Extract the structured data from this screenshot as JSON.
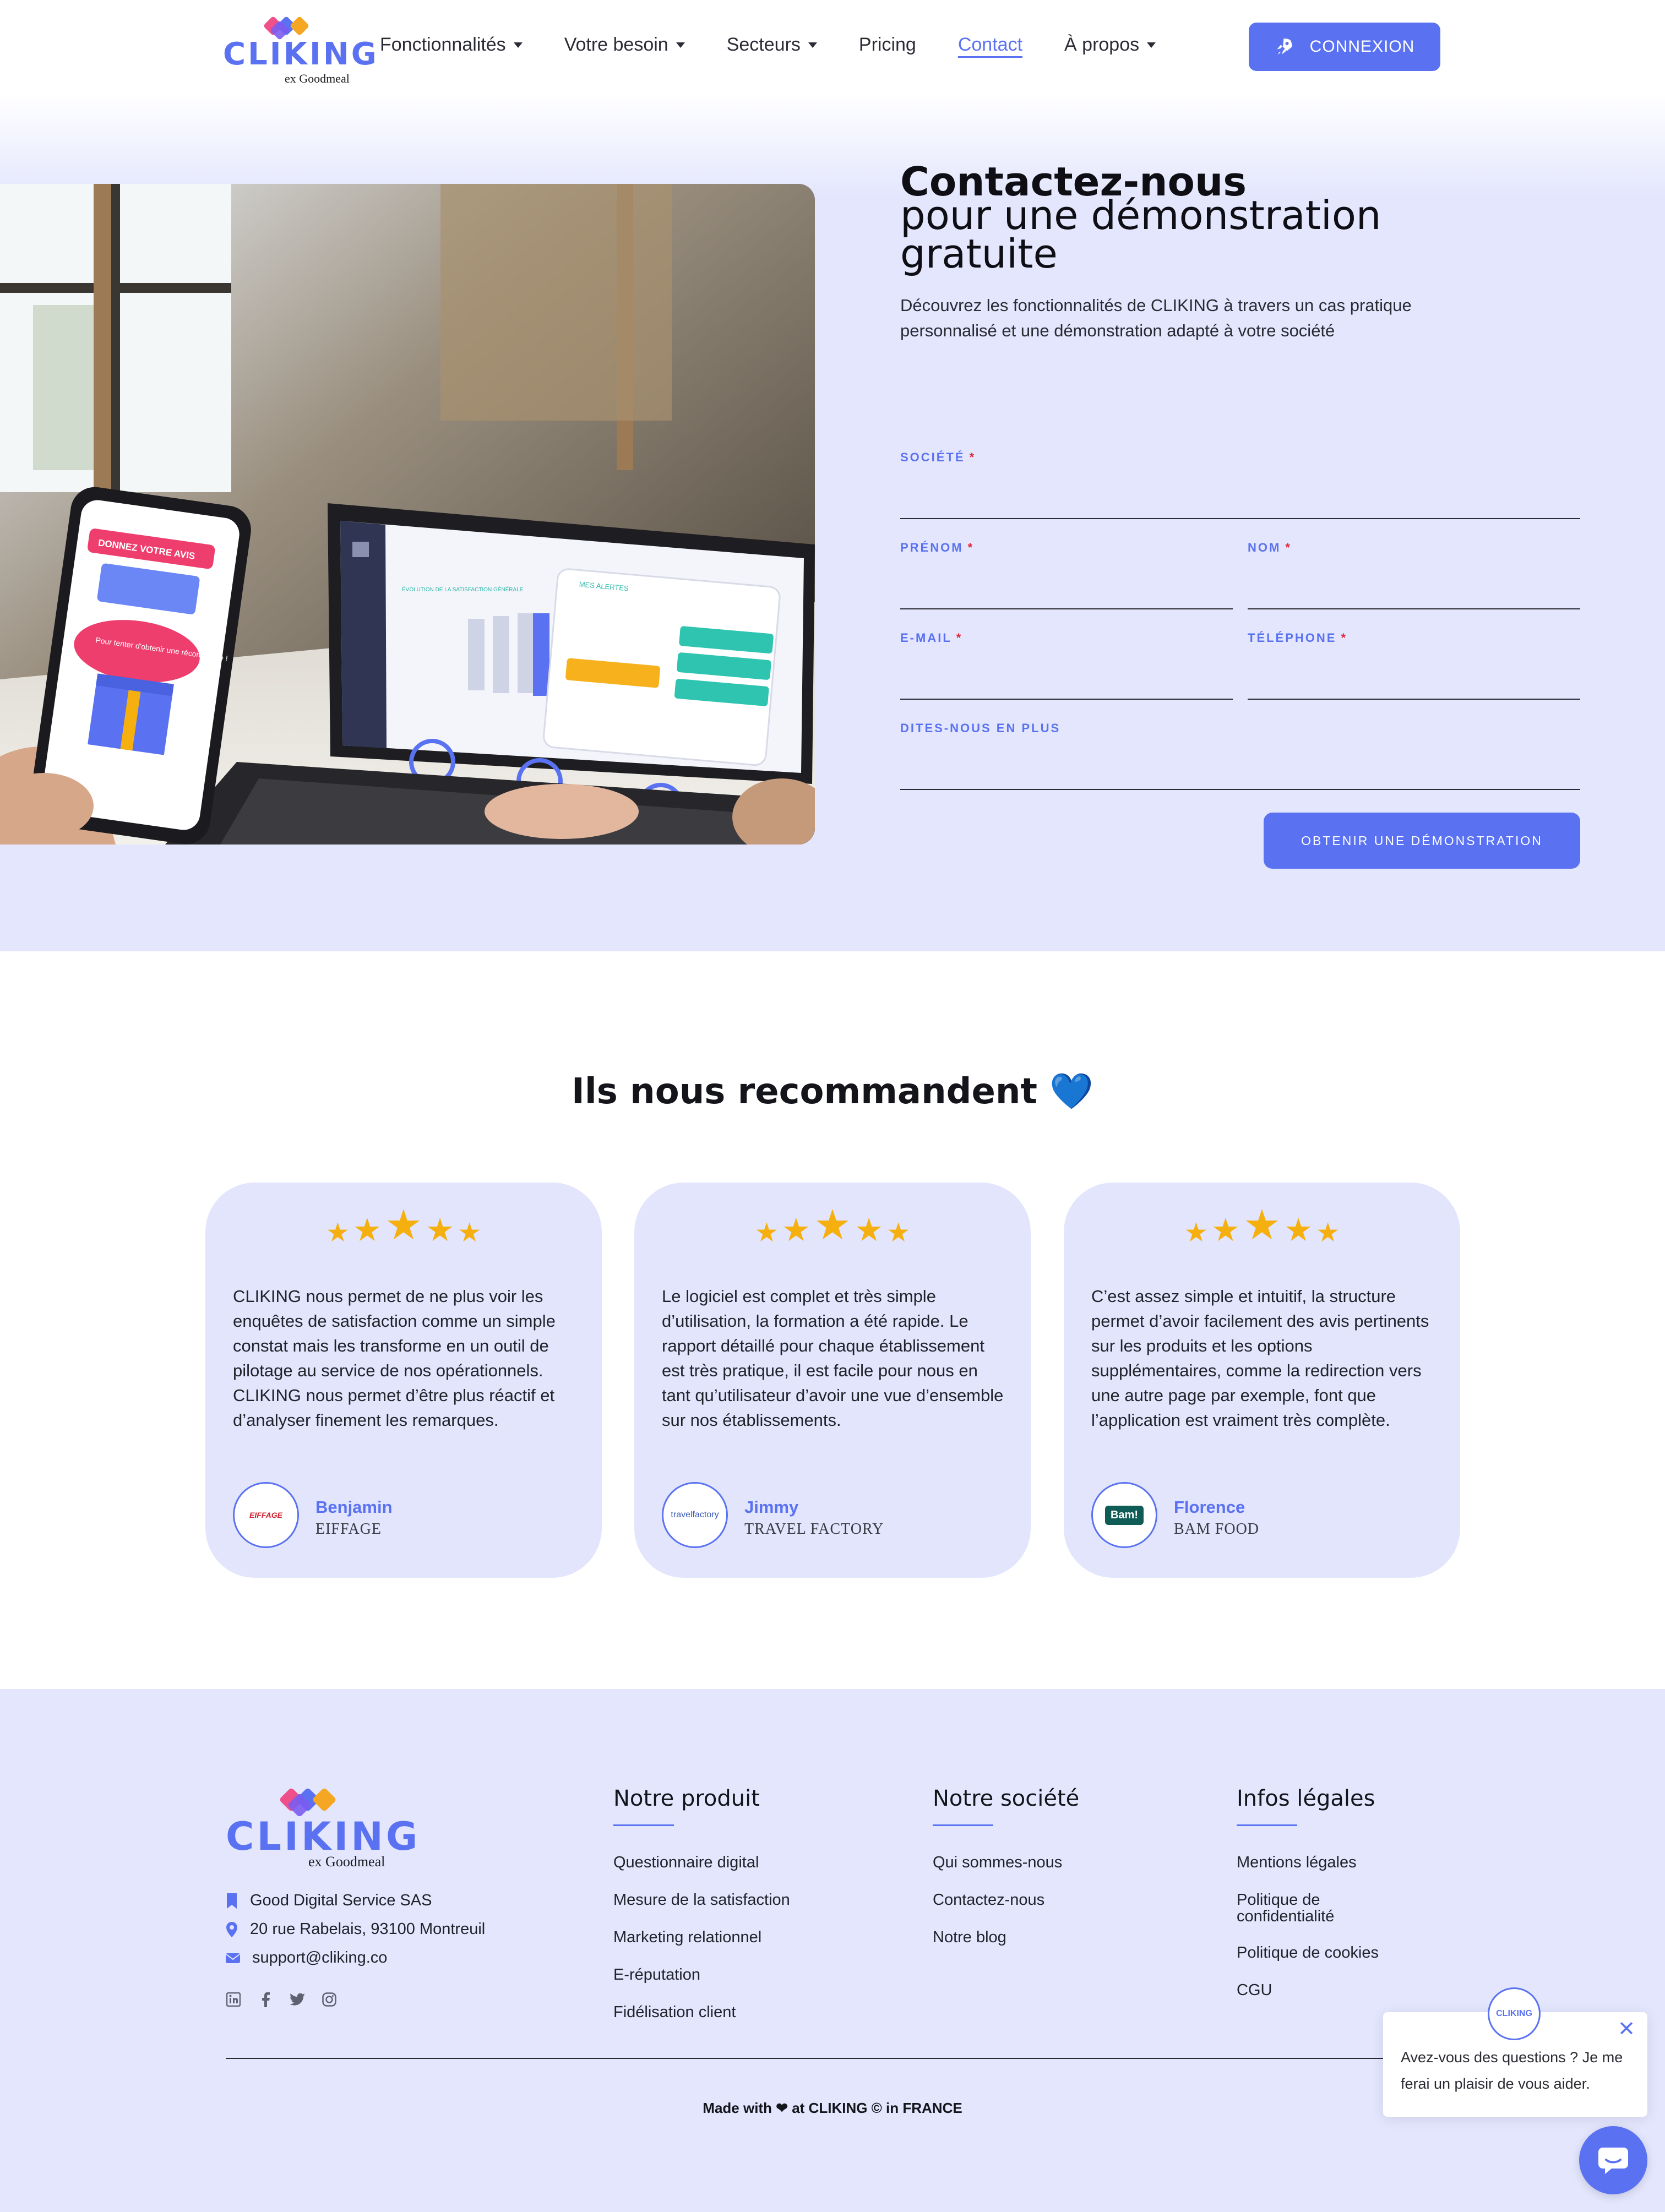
{
  "brand": {
    "name": "CLIKING",
    "sub": "ex Goodmeal",
    "accent": "#5a72f2",
    "hero_bg": "#e3e6fd"
  },
  "nav": {
    "items": [
      {
        "label": "Fonctionnalités",
        "dropdown": true
      },
      {
        "label": "Votre besoin",
        "dropdown": true
      },
      {
        "label": "Secteurs",
        "dropdown": true
      },
      {
        "label": "Pricing",
        "dropdown": false
      },
      {
        "label": "Contact",
        "dropdown": false,
        "active": true
      },
      {
        "label": "À propos",
        "dropdown": true
      }
    ],
    "cta_label": "CONNEXION",
    "cta_icon": "rocket-icon"
  },
  "hero": {
    "title_bold": "Contactez-nous",
    "title_rest": "pour une démonstration gratuite",
    "description": "Découvrez les fonctionnalités de CLIKING à travers un cas pratique personnalisé et une démonstration adapté à votre société",
    "photo": {
      "phone_banner": "DONNEZ VOTRE AVIS",
      "phone_text": "Pour tenter d'obtenir une récompense !",
      "laptop_alerts_title": "MES ALERTES"
    }
  },
  "form": {
    "societe": {
      "label": "SOCIÉTÉ",
      "required": "*",
      "value": ""
    },
    "prenom": {
      "label": "PRÉNOM",
      "required": "*",
      "value": ""
    },
    "nom": {
      "label": "NOM",
      "required": "*",
      "value": ""
    },
    "email": {
      "label": "E-MAIL",
      "required": "*",
      "value": ""
    },
    "telephone": {
      "label": "TÉLÉPHONE",
      "required": "*",
      "value": ""
    },
    "message": {
      "label": "DITES-NOUS EN PLUS",
      "value": ""
    },
    "submit_label": "OBTENIR UNE DÉMONSTRATION"
  },
  "testimonials": {
    "title": "Ils nous recommandent 💙",
    "cards": [
      {
        "stars": 5,
        "text": "CLIKING nous permet de ne plus voir les enquêtes de satisfaction comme un simple constat mais les transforme en un outil de pilotage au service de nos opérationnels. CLIKING nous permet d’être plus réactif et d’analyser finement les remarques.",
        "name": "Benjamin",
        "company": "EIFFAGE",
        "logo_text": "EIFFAGE"
      },
      {
        "stars": 5,
        "text": "Le logiciel est complet et très simple d’utilisation, la formation a été rapide. Le rapport détaillé pour chaque établissement est très pratique, il est facile pour nous en tant qu’utilisateur d’avoir une vue d’ensemble sur nos établissements.",
        "name": "Jimmy",
        "company": "TRAVEL FACTORY",
        "logo_text": "travelfactory"
      },
      {
        "stars": 5,
        "text": "C’est assez simple et intuitif, la structure permet d’avoir facilement des avis pertinents sur les produits et les options supplémentaires, comme la redirection vers une autre page par exemple, font que l’application est vraiment très complète.",
        "name": "Florence",
        "company": "BAM FOOD",
        "logo_text": "Bam!"
      }
    ]
  },
  "footer": {
    "company": "Good Digital Service SAS",
    "address": "20 rue Rabelais, 93100 Montreuil",
    "email": "support@cliking.co",
    "social": [
      "linkedin-icon",
      "facebook-icon",
      "twitter-icon",
      "instagram-icon"
    ],
    "columns": [
      {
        "title": "Notre produit",
        "links": [
          "Questionnaire digital",
          "Mesure de la satisfaction",
          "Marketing relationnel",
          "E-réputation",
          "Fidélisation client"
        ]
      },
      {
        "title": "Notre société",
        "links": [
          "Qui sommes-nous",
          "Contactez-nous",
          "Notre blog"
        ]
      },
      {
        "title": "Infos légales",
        "links": [
          "Mentions légales",
          "Politique de confidentialité",
          "Politique de cookies",
          "CGU"
        ]
      }
    ],
    "made_prefix": "Made with",
    "made_suffix": "at CLIKING © in FRANCE"
  },
  "chat": {
    "message": "Avez-vous des questions ? Je me ferai un plaisir de vous aider.",
    "avatar_label": "CLIKING"
  }
}
